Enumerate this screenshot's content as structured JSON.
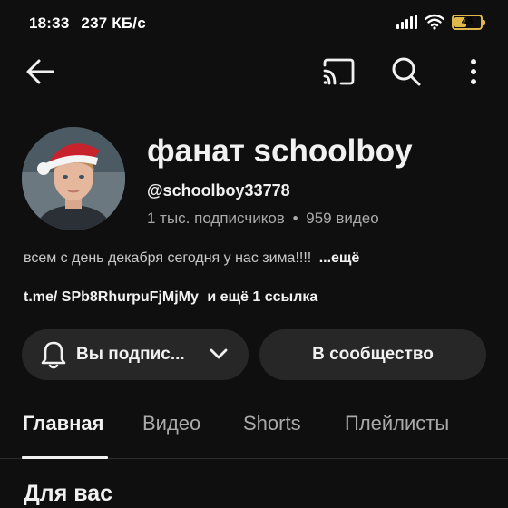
{
  "status_bar": {
    "time": "18:33",
    "speed": "237 КБ/с",
    "battery_level": "45",
    "battery_fraction": 0.45,
    "battery_color": "#e0b84a"
  },
  "top_bar": {
    "back_icon": "arrow-back-icon",
    "cast_icon": "cast-icon",
    "search_icon": "search-icon",
    "more_icon": "more-vert-icon"
  },
  "channel": {
    "name": "фанат schoolboy",
    "handle": "@schoolboy33778",
    "subscribers": "1 тыс. подписчиков",
    "separator": "•",
    "videos": "959 видео",
    "description": "всем с день декабря сегодня у нас зима!!!!",
    "description_more": "...ещё",
    "link_url": "t.me/ SPb8RhurpuFjMjMy",
    "link_more": "и ещё 1 ссылка"
  },
  "buttons": {
    "subscribed": "Вы подпис...",
    "community": "В сообщество"
  },
  "tabs": [
    {
      "label": "Главная",
      "active": true
    },
    {
      "label": "Видео",
      "active": false
    },
    {
      "label": "Shorts",
      "active": false
    },
    {
      "label": "Плейлисты",
      "active": false
    }
  ],
  "section": {
    "title": "Для вас"
  },
  "colors": {
    "background": "#0f0f0f",
    "pill": "#272727",
    "text_primary": "#f1f1f1",
    "text_secondary": "#aaaaaa"
  }
}
